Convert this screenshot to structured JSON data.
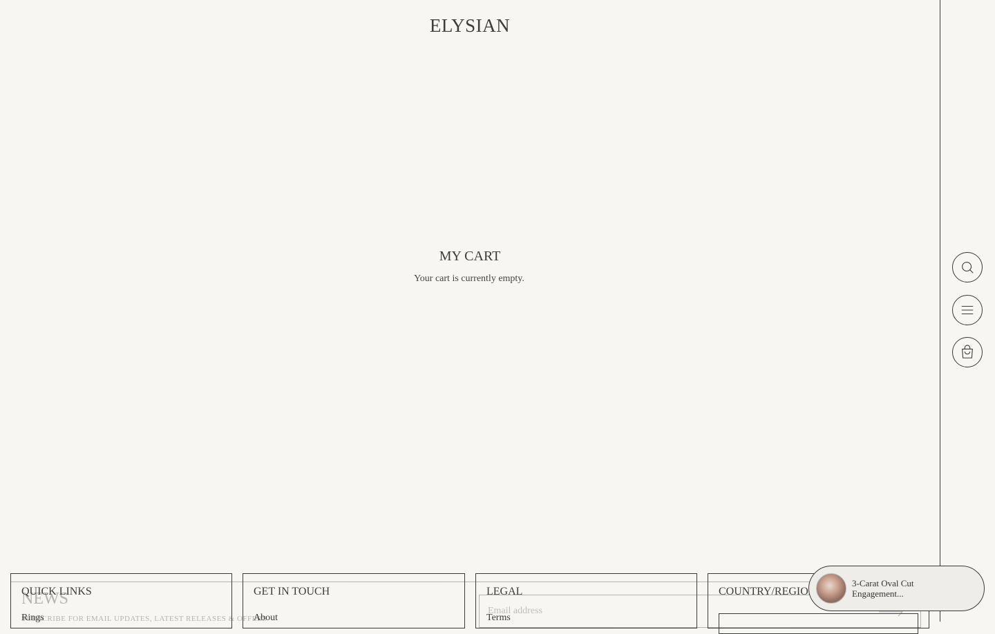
{
  "brand": {
    "logo": "ELYSIAN"
  },
  "cart": {
    "title": "MY CART",
    "empty_message": "Your cart is currently empty."
  },
  "side_nav": {
    "search": "search-icon",
    "menu": "menu-icon",
    "cart": "bag-icon"
  },
  "newsletter": {
    "title": "NEWS",
    "subtitle": "SUBSCRIBE FOR EMAIL UPDATES, LATEST RELEASES & OFFERS",
    "email_placeholder": "Email address"
  },
  "footer": {
    "quick_links": {
      "heading": "QUICK LINKS",
      "first_link": "Rings"
    },
    "get_in_touch": {
      "heading": "GET IN TOUCH",
      "first_link": "About"
    },
    "legal": {
      "heading": "LEGAL",
      "first_link": "Terms"
    },
    "country": {
      "heading": "COUNTRY/REGION"
    }
  },
  "recent_product": {
    "name": "3-Carat Oval Cut Engagement..."
  },
  "colors": {
    "background": "#f7f6f2",
    "ink": "#3a3a3a",
    "pill": "#eeede9"
  }
}
